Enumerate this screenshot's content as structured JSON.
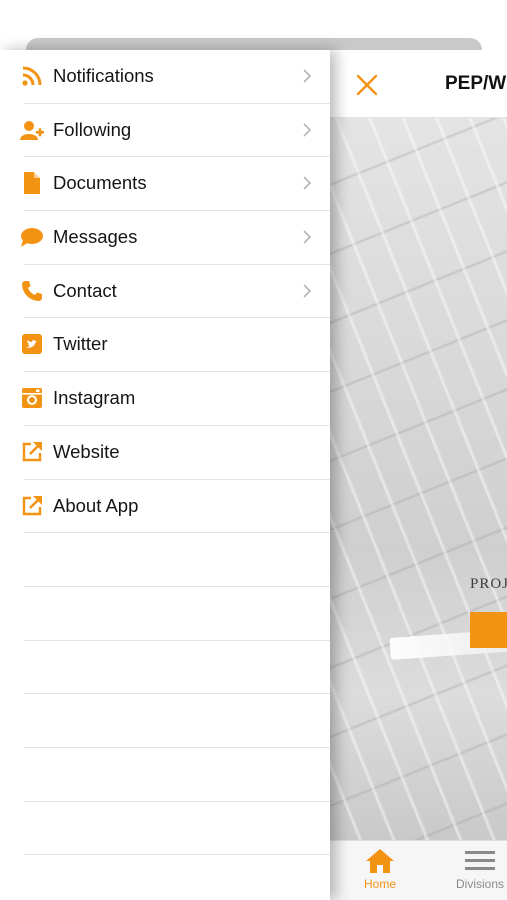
{
  "colors": {
    "accent": "#f39313",
    "divider": "#e4e4e4",
    "chevron": "#b5b5b5"
  },
  "menu": {
    "items": [
      {
        "label": "Notifications",
        "icon": "rss-icon",
        "has_chevron": true
      },
      {
        "label": "Following",
        "icon": "add-user-icon",
        "has_chevron": true
      },
      {
        "label": "Documents",
        "icon": "document-icon",
        "has_chevron": true
      },
      {
        "label": "Messages",
        "icon": "chat-bubble-icon",
        "has_chevron": true
      },
      {
        "label": "Contact",
        "icon": "phone-icon",
        "has_chevron": true
      },
      {
        "label": "Twitter",
        "icon": "twitter-icon",
        "has_chevron": false
      },
      {
        "label": "Instagram",
        "icon": "instagram-icon",
        "has_chevron": false
      },
      {
        "label": "Website",
        "icon": "external-link-icon",
        "has_chevron": false
      },
      {
        "label": "About App",
        "icon": "external-link-icon",
        "has_chevron": false
      }
    ]
  },
  "main": {
    "title": "PEP/W",
    "hero_text": "PROJ",
    "tabs": [
      {
        "label": "Home",
        "icon": "home-icon",
        "active": true
      },
      {
        "label": "Divisions",
        "icon": "menu-lines-icon",
        "active": false
      }
    ]
  }
}
